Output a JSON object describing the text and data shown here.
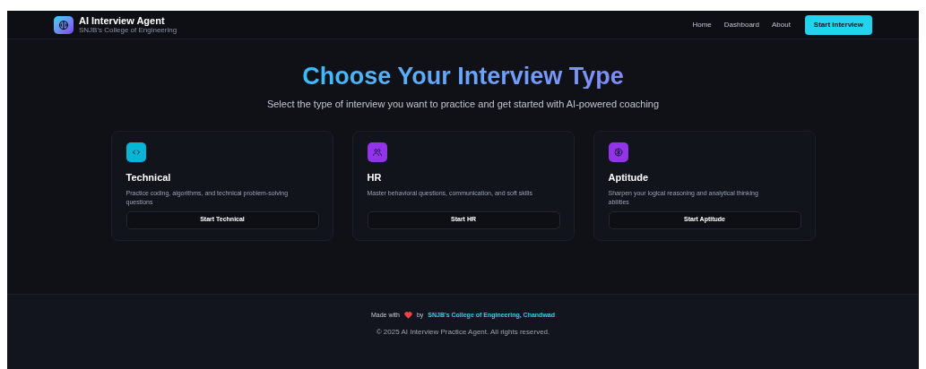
{
  "brand": {
    "title": "AI Interview Agent",
    "subtitle": "SNJB's College of Engineering"
  },
  "nav": {
    "links": [
      "Home",
      "Dashboard",
      "About"
    ],
    "cta": "Start Interview"
  },
  "hero": {
    "title": "Choose Your Interview Type",
    "subtitle": "Select the type of interview you want to practice and get started with AI-powered coaching"
  },
  "cards": [
    {
      "kind": "code",
      "color": "#06b6d4",
      "title": "Technical",
      "description": "Practice coding, algorithms, and technical problem-solving questions",
      "button": "Start Technical"
    },
    {
      "kind": "people",
      "color": "#9333ea",
      "title": "HR",
      "description": "Master behavioral questions, communication, and soft skills",
      "button": "Start HR"
    },
    {
      "kind": "brain",
      "color": "#9333ea",
      "title": "Aptitude",
      "description": "Sharpen your logical reasoning and analytical thinking abilities",
      "button": "Start Aptitude"
    }
  ],
  "footer": {
    "made_with": "Made with",
    "by": "by",
    "link": "SNJB's College of Engineering, Chandwad",
    "copyright": "© 2025 AI Interview Practice Agent. All rights reserved."
  }
}
